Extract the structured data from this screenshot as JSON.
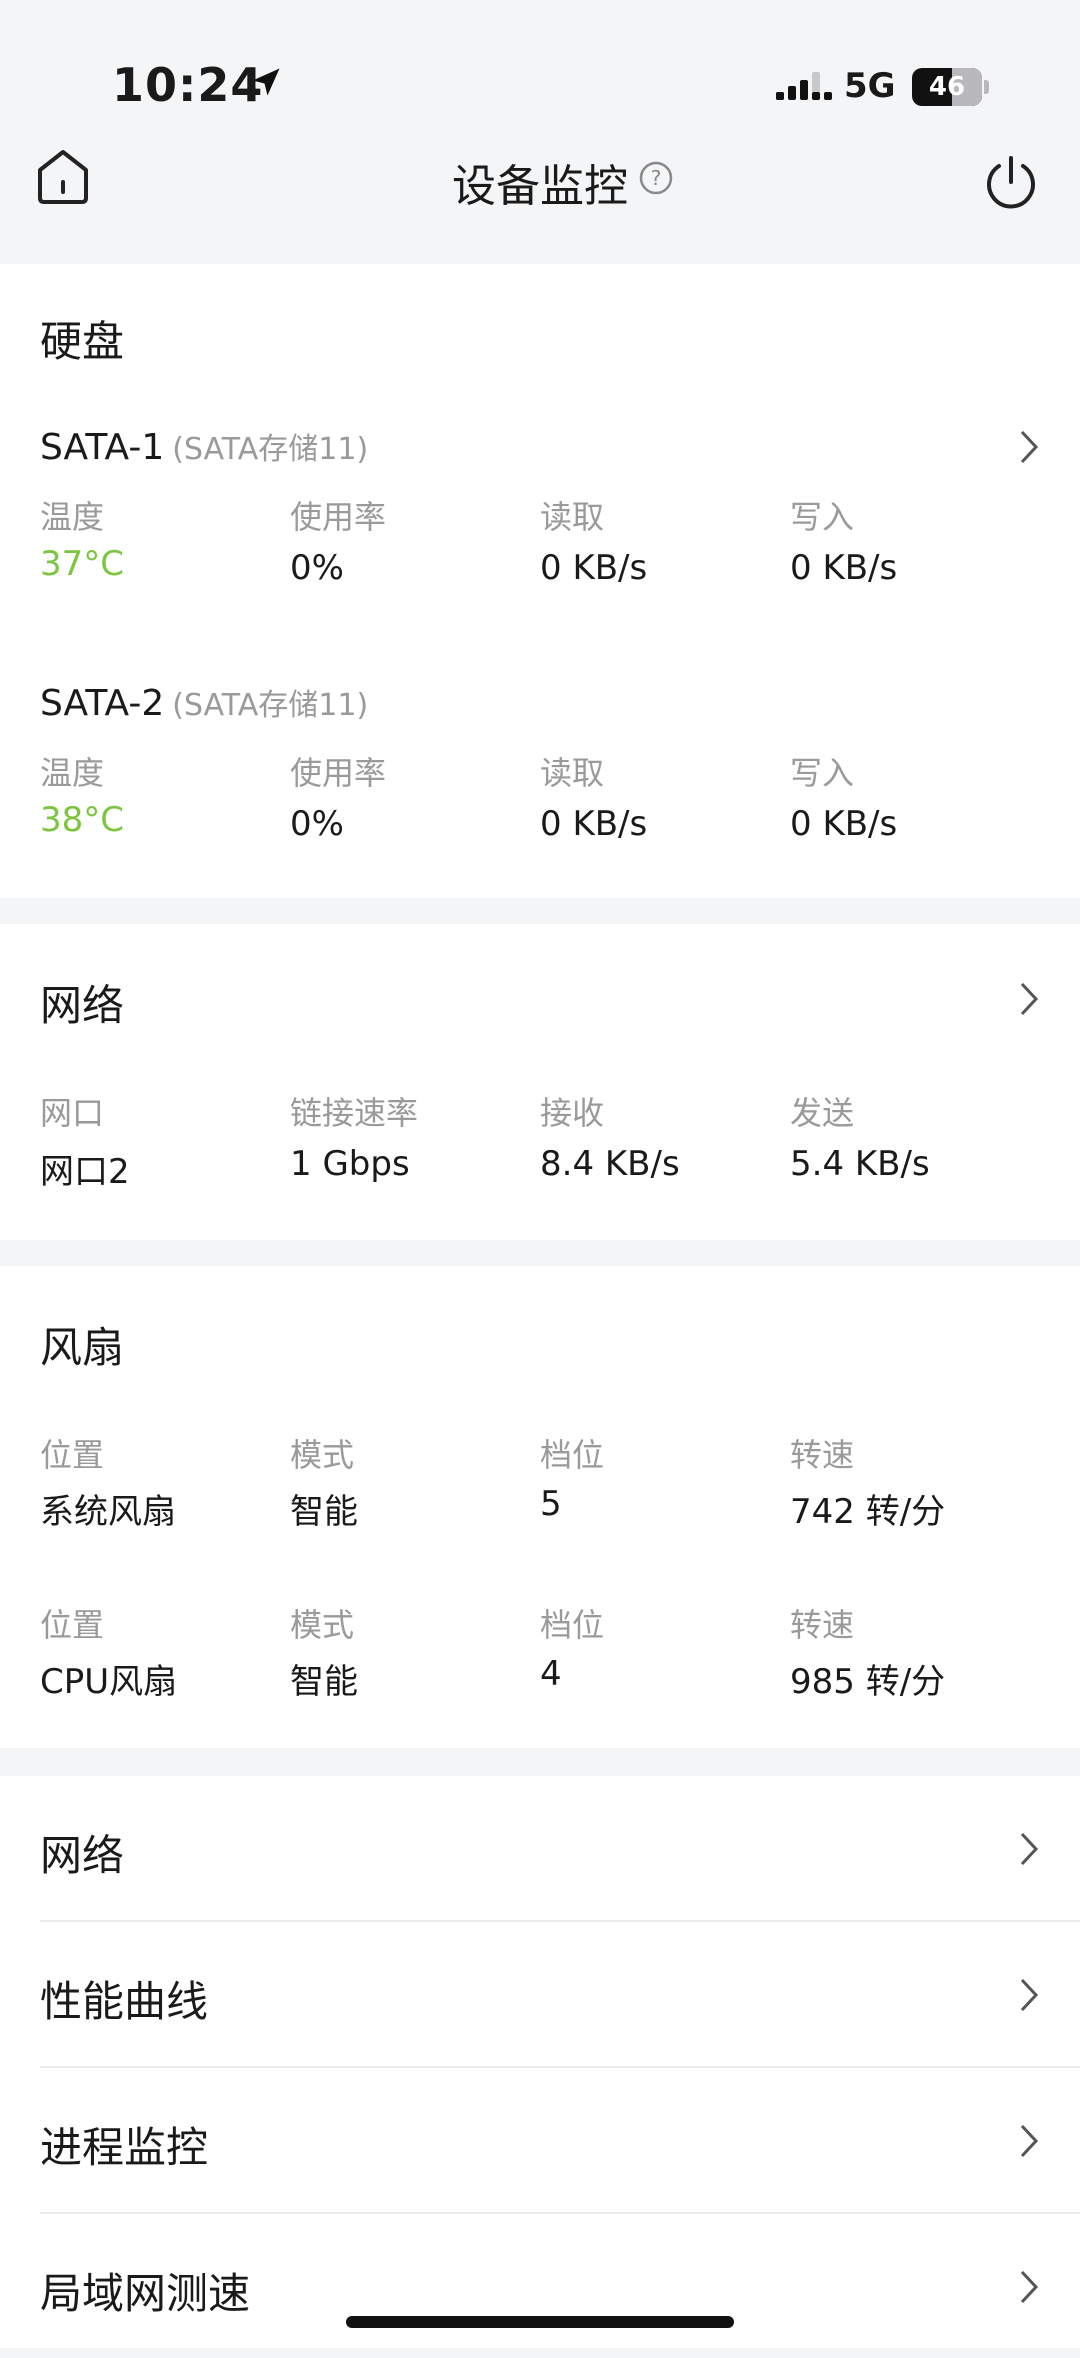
{
  "status": {
    "time": "10:24",
    "network": "5G",
    "battery": "46"
  },
  "header": {
    "title": "设备监控"
  },
  "disk": {
    "title": "硬盘",
    "items": [
      {
        "name": "SATA-1",
        "sub": "(SATA存储11)",
        "temp_label": "温度",
        "temp": "37°C",
        "usage_label": "使用率",
        "usage": "0%",
        "read_label": "读取",
        "read": "0 KB/s",
        "write_label": "写入",
        "write": "0 KB/s"
      },
      {
        "name": "SATA-2",
        "sub": "(SATA存储11)",
        "temp_label": "温度",
        "temp": "38°C",
        "usage_label": "使用率",
        "usage": "0%",
        "read_label": "读取",
        "read": "0 KB/s",
        "write_label": "写入",
        "write": "0 KB/s"
      }
    ]
  },
  "network": {
    "title": "网络",
    "port_label": "网口",
    "port": "网口2",
    "speed_label": "链接速率",
    "speed": "1 Gbps",
    "rx_label": "接收",
    "rx": "8.4 KB/s",
    "tx_label": "发送",
    "tx": "5.4 KB/s"
  },
  "fan": {
    "title": "风扇",
    "items": [
      {
        "pos_label": "位置",
        "pos": "系统风扇",
        "mode_label": "模式",
        "mode": "智能",
        "level_label": "档位",
        "level": "5",
        "rpm_label": "转速",
        "rpm": "742 转/分"
      },
      {
        "pos_label": "位置",
        "pos": "CPU风扇",
        "mode_label": "模式",
        "mode": "智能",
        "level_label": "档位",
        "level": "4",
        "rpm_label": "转速",
        "rpm": "985 转/分"
      }
    ]
  },
  "menu": [
    "网络",
    "性能曲线",
    "进程监控",
    "局域网测速"
  ]
}
